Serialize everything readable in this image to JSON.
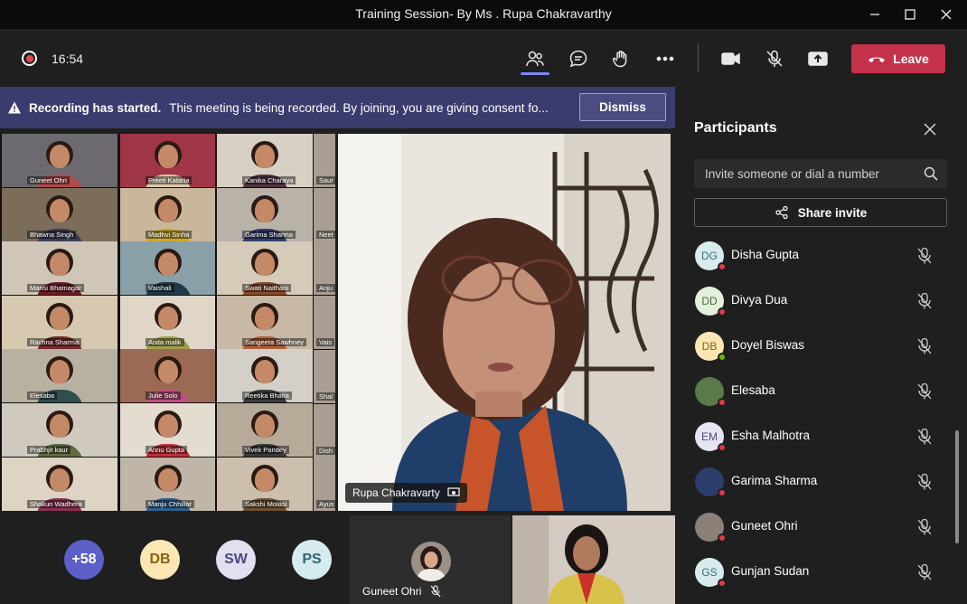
{
  "window": {
    "title": "Training Session- By Ms . Rupa Chakravarthy"
  },
  "toolbar": {
    "timer": "16:54",
    "leave_label": "Leave",
    "icons": [
      "participants-icon",
      "chat-icon",
      "raise-hand-icon",
      "more-icon",
      "camera-icon",
      "mic-off-icon",
      "share-screen-icon"
    ]
  },
  "banner": {
    "title": "Recording has started.",
    "text": "This meeting is being recorded. By joining, you are giving consent fo...",
    "dismiss_label": "Dismiss"
  },
  "gallery": [
    {
      "name": "Guneet Ohri",
      "bg": "#6c6a70",
      "body": "#b04a4a"
    },
    {
      "name": "Preeti  Kataria",
      "bg": "#a03545",
      "body": "#d9c7a6"
    },
    {
      "name": "Kanika Charaya",
      "bg": "#d8d0c4",
      "body": "#553344"
    },
    {
      "name": "Bhawna Singh",
      "bg": "#7c6d5b",
      "body": "#3b3b55"
    },
    {
      "name": "Madhvi Sinha",
      "bg": "#c9b79c",
      "body": "#c9a828"
    },
    {
      "name": "Garima Sharma",
      "bg": "#b9b2a8",
      "body": "#2f3d6b"
    },
    {
      "name": "Mansi Bhatnagar",
      "bg": "#cfc6b8",
      "body": "#6f1d2b"
    },
    {
      "name": "Vaishali",
      "bg": "#8aa0a8",
      "body": "#1f3a4a"
    },
    {
      "name": "Swati  Naithani",
      "bg": "#d6cbb8",
      "body": "#8a4a2a"
    },
    {
      "name": "Rachna Sharma",
      "bg": "#d6c9b0",
      "body": "#7a2a2a"
    },
    {
      "name": "Anita malik",
      "bg": "#e0d6c8",
      "body": "#a0a04a"
    },
    {
      "name": "Sangeeta Sawhney",
      "bg": "#c8b8a6",
      "body": "#b0603a"
    },
    {
      "name": "Elesaba",
      "bg": "#b8b0a0",
      "body": "#2f4f4f"
    },
    {
      "name": "Julie Solo",
      "bg": "#9c6a54",
      "body": "#c05080"
    },
    {
      "name": "Reetika Bhatia",
      "bg": "#d4cfc8",
      "body": "#3d3d3d"
    },
    {
      "name": "Prabhjit kaur",
      "bg": "#cfc9bf",
      "body": "#5d6b3d"
    },
    {
      "name": "Annu Gupta",
      "bg": "#e4dccf",
      "body": "#c0303a"
    },
    {
      "name": "Vivek  Pandey",
      "bg": "#b6aa98",
      "body": "#3a3a3a"
    },
    {
      "name": "Shakun Wadhera",
      "bg": "#ddd4c4",
      "body": "#8a3050"
    },
    {
      "name": "Manju Chhillar",
      "bg": "#c0b6a8",
      "body": "#2f5f8f"
    },
    {
      "name": "Sakshi Molasi",
      "bg": "#cdbfae",
      "body": "#705030"
    }
  ],
  "gallery_edge": [
    "Saur",
    "Neet",
    "Anju",
    "Vais",
    "Shal",
    "Dish",
    "Ayus"
  ],
  "main_video": {
    "speaker_name": "Rupa Chakravarty"
  },
  "strip": {
    "overflow_count": "+58",
    "avatars": [
      {
        "initials": "DB",
        "bg": "#fbe7b4",
        "fg": "#8a6210"
      },
      {
        "initials": "SW",
        "bg": "#e1dff0",
        "fg": "#4b4a7a"
      },
      {
        "initials": "PS",
        "bg": "#d6ebee",
        "fg": "#2d6670"
      }
    ],
    "overflow_bg": "#5b5fc7",
    "tile_name": "Guneet Ohri"
  },
  "panel": {
    "title": "Participants",
    "invite_placeholder": "Invite someone or dial a number",
    "share_label": "Share invite",
    "participants": [
      {
        "initials": "DG",
        "name": "Disha Gupta",
        "bg": "#d8ebee",
        "fg": "#3a6e78",
        "status": "#e0394a"
      },
      {
        "initials": "DD",
        "name": "Divya Dua",
        "bg": "#e4efdc",
        "fg": "#4a6a34",
        "status": "#e0394a"
      },
      {
        "initials": "DB",
        "name": "Doyel Biswas",
        "bg": "#fbe7b4",
        "fg": "#8a6210",
        "status": "#6bb700"
      },
      {
        "initials": "",
        "name": "Elesaba",
        "bg": "#5a7a4a",
        "fg": "#fff",
        "status": "#e0394a"
      },
      {
        "initials": "EM",
        "name": "Esha Malhotra",
        "bg": "#e7e5f3",
        "fg": "#4b4a7a",
        "status": "#e0394a"
      },
      {
        "initials": "",
        "name": "Garima Sharma",
        "bg": "#2d3d6b",
        "fg": "#fff",
        "status": "#e0394a"
      },
      {
        "initials": "",
        "name": "Guneet Ohri",
        "bg": "#8a8078",
        "fg": "#fff",
        "status": "#e0394a"
      },
      {
        "initials": "GS",
        "name": "Gunjan Sudan",
        "bg": "#d8ebee",
        "fg": "#3a6e78",
        "status": "#e0394a"
      }
    ]
  }
}
